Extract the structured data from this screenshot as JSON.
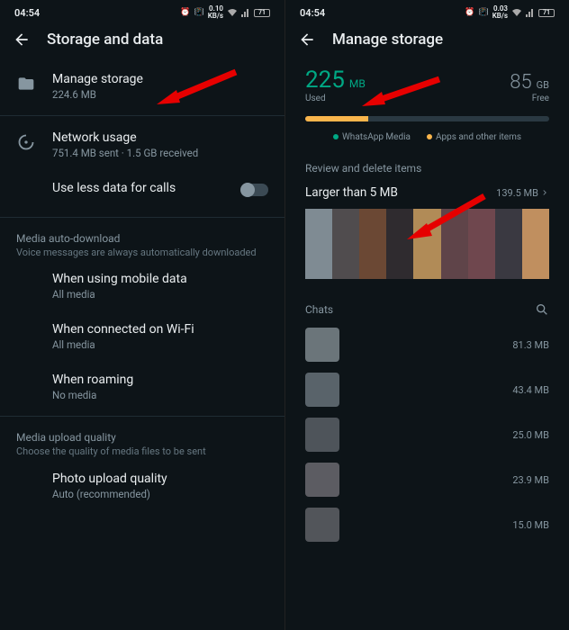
{
  "status": {
    "time": "04:54",
    "speed1": "0.10",
    "speed2": "0.03",
    "speed_unit": "KB/s",
    "battery": "71"
  },
  "left": {
    "title": "Storage and data",
    "manage": {
      "label": "Manage storage",
      "sub": "224.6 MB"
    },
    "network": {
      "label": "Network usage",
      "sub": "751.4 MB sent · 1.5 GB received"
    },
    "less_data": {
      "label": "Use less data for calls"
    },
    "media_auto": {
      "title": "Media auto-download",
      "desc": "Voice messages are always automatically downloaded"
    },
    "mobile": {
      "label": "When using mobile data",
      "sub": "All media"
    },
    "wifi": {
      "label": "When connected on Wi-Fi",
      "sub": "All media"
    },
    "roaming": {
      "label": "When roaming",
      "sub": "No media"
    },
    "upload": {
      "title": "Media upload quality",
      "desc": "Choose the quality of media files to be sent"
    },
    "photo": {
      "label": "Photo upload quality",
      "sub": "Auto (recommended)"
    }
  },
  "right": {
    "title": "Manage storage",
    "used_val": "225",
    "used_unit": "MB",
    "used_label": "Used",
    "free_val": "85",
    "free_unit": "GB",
    "free_label": "Free",
    "legend1": "WhatsApp Media",
    "legend2": "Apps and other items",
    "review_title": "Review and delete items",
    "larger": {
      "label": "Larger than 5 MB",
      "size": "139.5 MB"
    },
    "chats_title": "Chats",
    "chats": [
      {
        "size": "81.3 MB"
      },
      {
        "size": "43.4 MB"
      },
      {
        "size": "25.0 MB"
      },
      {
        "size": "23.9 MB"
      },
      {
        "size": "15.0 MB"
      }
    ]
  }
}
